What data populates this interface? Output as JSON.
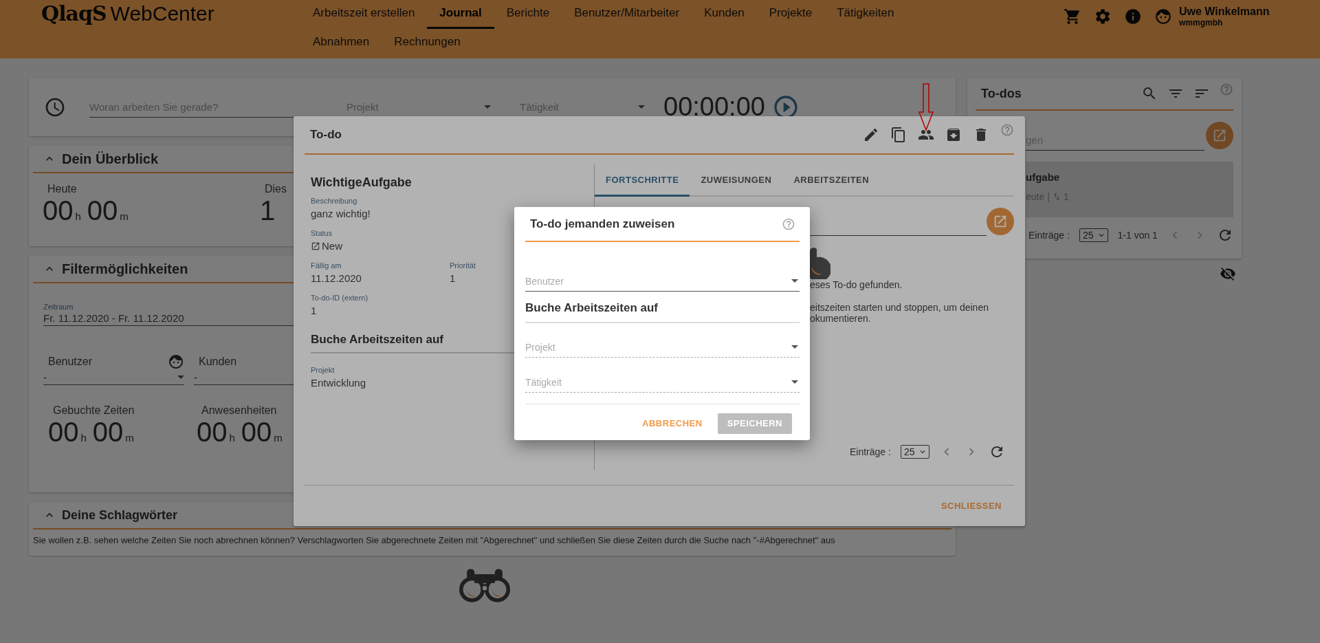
{
  "header": {
    "logo_brand": "QlaqS",
    "logo_product": "WebCenter",
    "nav_rows": [
      [
        {
          "label": "Arbeitszeit erstellen",
          "selected": false
        },
        {
          "label": "Journal",
          "selected": true
        },
        {
          "label": "Berichte",
          "selected": false
        },
        {
          "label": "Benutzer/Mitarbeiter",
          "selected": false
        },
        {
          "label": "Kunden",
          "selected": false
        },
        {
          "label": "Projekte",
          "selected": false
        },
        {
          "label": "Tätigkeiten",
          "selected": false
        }
      ],
      [
        {
          "label": "Abnahmen",
          "selected": false
        },
        {
          "label": "Rechnungen",
          "selected": false
        }
      ]
    ],
    "user": {
      "name": "Uwe Winkelmann",
      "company": "wmmgmbh"
    }
  },
  "timer": {
    "placeholder": "Woran arbeiten Sie gerade?",
    "project_placeholder": "Projekt",
    "activity_placeholder": "Tätigkeit",
    "time": "00:00:00"
  },
  "overview": {
    "title": "Dein Überblick",
    "expanded": true,
    "stats": [
      {
        "label": "Heute",
        "hours": "00",
        "hours_unit": "h",
        "minutes": "00",
        "minutes_unit": "m"
      },
      {
        "label": "Dies",
        "hours": "1"
      }
    ]
  },
  "filters": {
    "title": "Filtermöglichkeiten",
    "expanded": true,
    "period_label": "Zeitraum",
    "period_value": "Fr. 11.12.2020 - Fr. 11.12.2020",
    "selects": [
      {
        "label": "Benutzer",
        "value": "-"
      },
      {
        "label": "Kunden",
        "value": "-"
      }
    ],
    "stats": [
      {
        "label": "Gebuchte Zeiten",
        "hours": "00",
        "hours_unit": "h",
        "minutes": "00",
        "minutes_unit": "m"
      },
      {
        "label": "Anwesenheiten",
        "hours": "00",
        "hours_unit": "h",
        "minutes": "00",
        "minutes_unit": "m"
      }
    ]
  },
  "tags": {
    "title": "Deine Schlagwörter",
    "expanded": true,
    "hint": "Sie wollen z.B. sehen welche Zeiten Sie noch abrechnen können? Verschlagworten Sie abgerechnete Zeiten mit \"Abgerechnet\" und schließen Sie diese Zeiten durch die Suche nach \"-#Abgerechnet\" aus"
  },
  "todos_panel": {
    "title": "To-dos",
    "search_placeholder": "gen",
    "items": [
      {
        "title": "ufgabe",
        "meta": "eute |",
        "count": "1",
        "selected": true
      }
    ],
    "entries_label": "Einträge :",
    "page_size": "25",
    "range": "1-1 von 1"
  },
  "todo_dialog": {
    "title": "To-do",
    "name": "WichtigeAufgabe",
    "fields": [
      {
        "label": "Beschreibung",
        "value": "ganz wichtig!"
      },
      {
        "label": "Status",
        "value": "New"
      }
    ],
    "due_label": "Fällig am",
    "due_value": "11.12.2020",
    "priority_label": "Priorität",
    "priority_value": "1",
    "external_id_label": "To-do-ID (extern)",
    "external_id_value": "1",
    "booking_heading": "Buche Arbeitszeiten auf",
    "project_label": "Projekt",
    "project_value": "Entwicklung",
    "tabs": [
      {
        "label": "FORTSCHRITTE",
        "selected": true
      },
      {
        "label": "ZUWEISUNGEN",
        "selected": false
      },
      {
        "label": "ARBEITSZEITEN",
        "selected": false
      }
    ],
    "empty_lines": [
      "eses To-do gefunden.",
      "eitszeiten starten und stoppen, um deinen",
      "okumentieren."
    ],
    "entries_label": "Einträge :",
    "page_size": "25",
    "close_label": "SCHLIESSEN"
  },
  "assign_dialog": {
    "title": "To-do jemanden zuweisen",
    "user_placeholder": "Benutzer",
    "booking_heading": "Buche Arbeitszeiten auf",
    "project_placeholder": "Projekt",
    "activity_placeholder": "Tätigkeit",
    "cancel_label": "ABBRECHEN",
    "save_label": "SPEICHERN",
    "save_disabled": true
  }
}
